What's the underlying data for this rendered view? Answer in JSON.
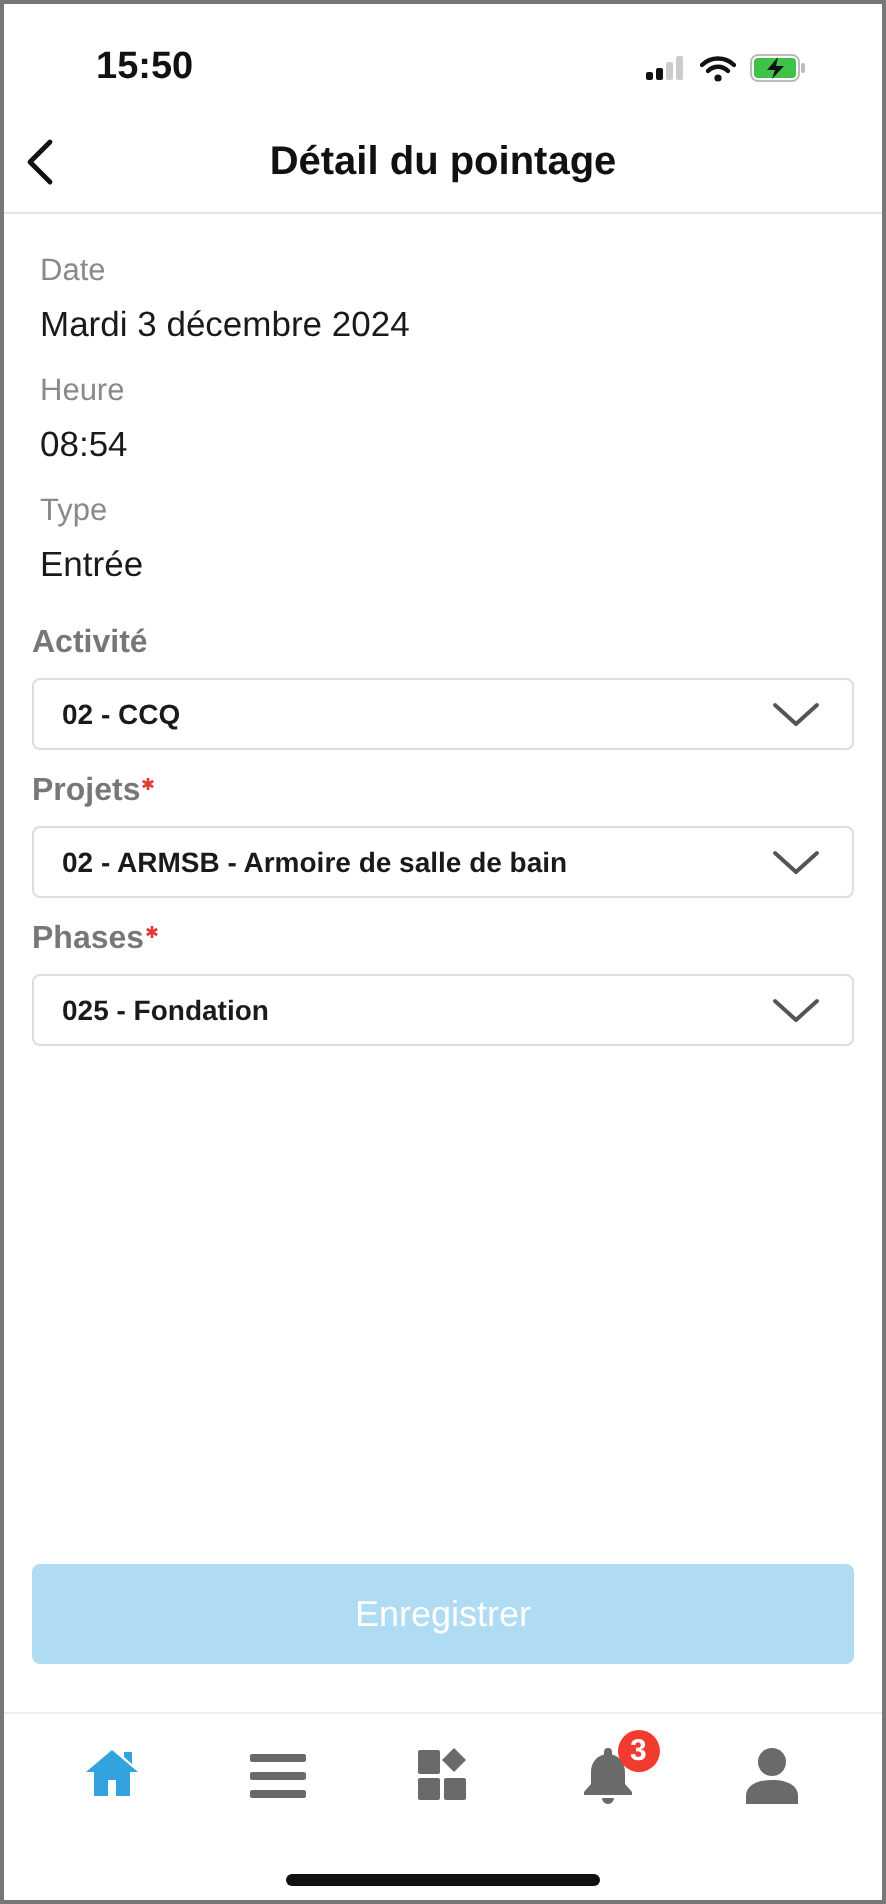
{
  "status_bar": {
    "time": "15:50"
  },
  "header": {
    "title": "Détail du pointage"
  },
  "details": [
    {
      "label": "Date",
      "value": "Mardi 3 décembre 2024"
    },
    {
      "label": "Heure",
      "value": "08:54"
    },
    {
      "label": "Type",
      "value": "Entrée"
    }
  ],
  "selects": [
    {
      "label": "Activité",
      "required": false,
      "value": "02 - CCQ"
    },
    {
      "label": "Projets",
      "required": true,
      "value": "02 - ARMSB - Armoire de salle de bain"
    },
    {
      "label": "Phases",
      "required": true,
      "value": "025 - Fondation"
    }
  ],
  "save_button": {
    "label": "Enregistrer",
    "disabled": true
  },
  "tab_bar": [
    {
      "kind": "home",
      "selected": true
    },
    {
      "kind": "menu",
      "selected": false
    },
    {
      "kind": "apps",
      "selected": false
    },
    {
      "kind": "bell",
      "selected": false,
      "badge": "3"
    },
    {
      "kind": "user",
      "selected": false
    }
  ]
}
